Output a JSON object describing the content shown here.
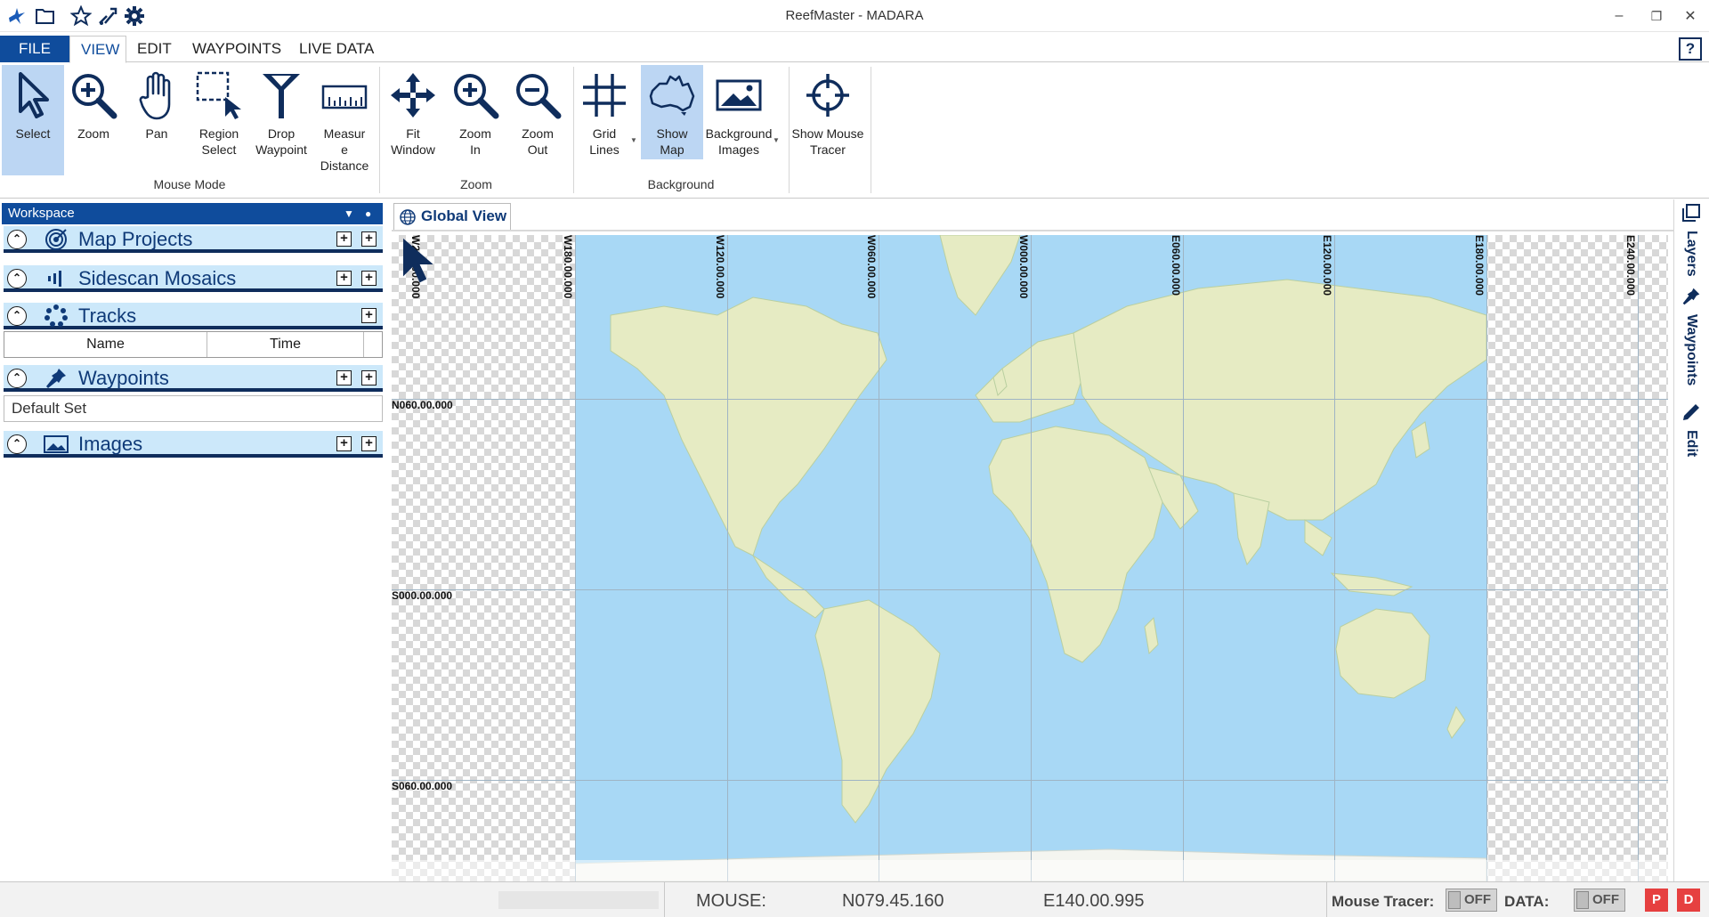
{
  "window": {
    "title": "ReefMaster - MADARA"
  },
  "quick_access": [
    "app-logo-icon",
    "open-folder-icon",
    "star-icon",
    "waypoint-flag-icon",
    "settings-gear-icon"
  ],
  "menu": {
    "tabs": [
      "FILE",
      "VIEW",
      "EDIT",
      "WAYPOINTS",
      "LIVE DATA"
    ],
    "active": "VIEW",
    "help": "?"
  },
  "ribbon": {
    "mouse_mode": {
      "label": "Mouse Mode",
      "buttons": [
        {
          "line1": "Select",
          "line2": "",
          "line3": "",
          "selected": true
        },
        {
          "line1": "Zoom",
          "line2": "",
          "line3": ""
        },
        {
          "line1": "Pan",
          "line2": "",
          "line3": ""
        },
        {
          "line1": "Region",
          "line2": "Select",
          "line3": ""
        },
        {
          "line1": "Drop",
          "line2": "Waypoint",
          "line3": ""
        },
        {
          "line1": "Measur",
          "line2": "e",
          "line3": "Distance"
        }
      ]
    },
    "zoom": {
      "label": "Zoom",
      "buttons": [
        {
          "line1": "Fit",
          "line2": "Window"
        },
        {
          "line1": "Zoom",
          "line2": "In"
        },
        {
          "line1": "Zoom",
          "line2": "Out"
        }
      ]
    },
    "background": {
      "label": "Background",
      "buttons": [
        {
          "line1": "Grid",
          "line2": "Lines"
        },
        {
          "line1": "Show",
          "line2": "Map",
          "selected": true
        },
        {
          "line1": "Background",
          "line2": "Images"
        }
      ]
    },
    "tracer": {
      "line1": "Show Mouse",
      "line2": "Tracer"
    }
  },
  "workspace": {
    "title": "Workspace",
    "sections": {
      "map_projects": "Map Projects",
      "sidescan": "Sidescan Mosaics",
      "tracks": "Tracks",
      "waypoints": "Waypoints",
      "images": "Images"
    },
    "track_columns": [
      "Name",
      "Time"
    ],
    "waypoint_sets": [
      "Default Set"
    ]
  },
  "map": {
    "tab": "Global View",
    "lon_labels": [
      "W240.00.000",
      "W180.00.000",
      "W120.00.000",
      "W060.00.000",
      "W000.00.000",
      "E060.00.000",
      "E120.00.000",
      "E180.00.000",
      "E240.00.000"
    ],
    "lat_labels": [
      "N060.00.000",
      "S000.00.000",
      "S060.00.000"
    ],
    "colors": {
      "ocean": "#a8d8f5",
      "land": "#e6ebc3",
      "ice": "#f4f5f0"
    }
  },
  "side_tabs": [
    "Layers",
    "Waypoints",
    "Edit"
  ],
  "status": {
    "mouse_label": "MOUSE:",
    "lat": "N079.45.160",
    "lon": "E140.00.995",
    "tracer_label": "Mouse Tracer:",
    "tracer_state": "OFF",
    "data_label": "DATA:",
    "data_state": "OFF",
    "btn_p": "P",
    "btn_d": "D"
  }
}
